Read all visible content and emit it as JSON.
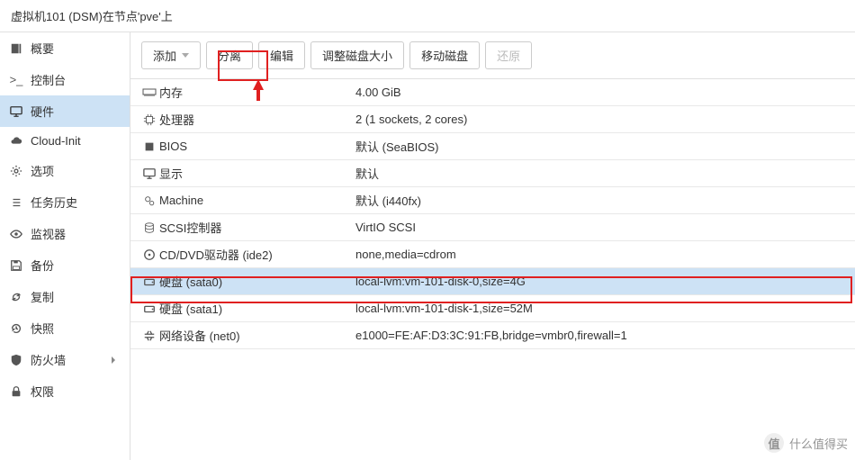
{
  "title": "虚拟机101 (DSM)在节点'pve'上",
  "sidebar": {
    "items": [
      {
        "label": "概要"
      },
      {
        "label": "控制台"
      },
      {
        "label": "硬件"
      },
      {
        "label": "Cloud-Init"
      },
      {
        "label": "选项"
      },
      {
        "label": "任务历史"
      },
      {
        "label": "监视器"
      },
      {
        "label": "备份"
      },
      {
        "label": "复制"
      },
      {
        "label": "快照"
      },
      {
        "label": "防火墙"
      },
      {
        "label": "权限"
      }
    ],
    "active_index": 2
  },
  "toolbar": {
    "add_label": "添加",
    "detach_label": "分离",
    "edit_label": "编辑",
    "resize_label": "调整磁盘大小",
    "move_label": "移动磁盘",
    "restore_label": "还原"
  },
  "hardware": {
    "rows": [
      {
        "icon": "memory",
        "label": "内存",
        "value": "4.00 GiB"
      },
      {
        "icon": "cpu",
        "label": "处理器",
        "value": "2 (1 sockets, 2 cores)"
      },
      {
        "icon": "bios",
        "label": "BIOS",
        "value": "默认 (SeaBIOS)"
      },
      {
        "icon": "display",
        "label": "显示",
        "value": "默认"
      },
      {
        "icon": "machine",
        "label": "Machine",
        "value": "默认 (i440fx)"
      },
      {
        "icon": "scsi",
        "label": "SCSI控制器",
        "value": "VirtIO SCSI"
      },
      {
        "icon": "cdrom",
        "label": "CD/DVD驱动器 (ide2)",
        "value": "none,media=cdrom"
      },
      {
        "icon": "disk",
        "label": "硬盘 (sata0)",
        "value": "local-lvm:vm-101-disk-0,size=4G"
      },
      {
        "icon": "disk",
        "label": "硬盘 (sata1)",
        "value": "local-lvm:vm-101-disk-1,size=52M"
      },
      {
        "icon": "net",
        "label": "网络设备 (net0)",
        "value": "e1000=FE:AF:D3:3C:91:FB,bridge=vmbr0,firewall=1"
      }
    ],
    "selected_index": 7
  },
  "watermark": {
    "z": "值",
    "text": "什么值得买"
  }
}
